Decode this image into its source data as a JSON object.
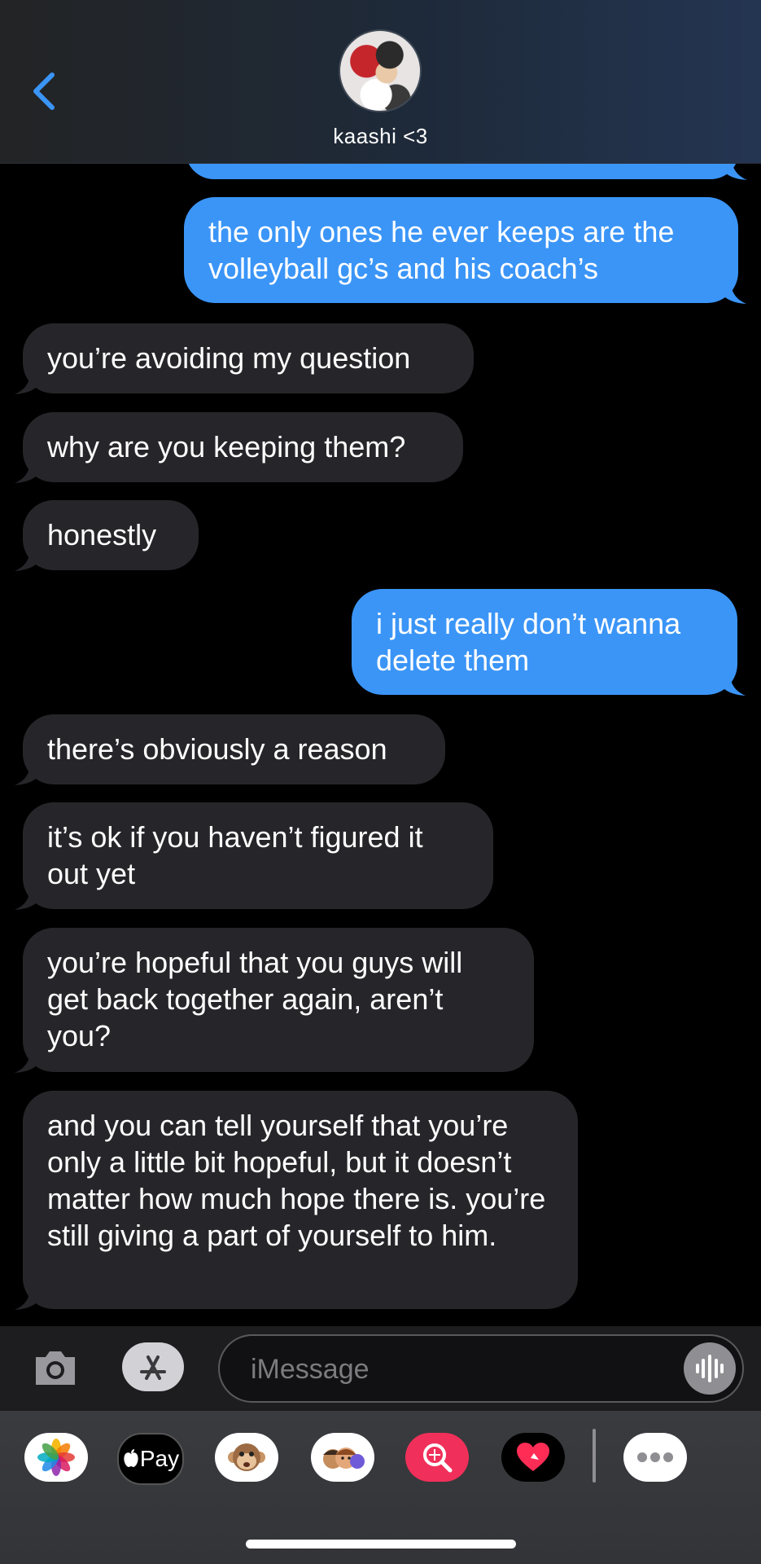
{
  "header": {
    "back_label": "back",
    "contact_name": "kaashi <3"
  },
  "messages": [
    {
      "direction": "outgoing",
      "text": ""
    },
    {
      "direction": "outgoing",
      "text": "the only ones he ever keeps are the volleyball gc’s and his coach’s"
    },
    {
      "direction": "incoming",
      "text": "you’re avoiding my question"
    },
    {
      "direction": "incoming",
      "text": "why are you keeping them?"
    },
    {
      "direction": "incoming",
      "text": "honestly"
    },
    {
      "direction": "outgoing",
      "text": "i just really don’t wanna delete them"
    },
    {
      "direction": "incoming",
      "text": "there’s obviously a reason"
    },
    {
      "direction": "incoming",
      "text": "it’s ok if you haven’t figured it out yet"
    },
    {
      "direction": "incoming",
      "text": "you’re hopeful that you guys will get back together again, aren’t you?"
    },
    {
      "direction": "incoming",
      "text": "and you can tell yourself that you’re only a little bit hopeful, but it doesn’t matter how much hope there is. you’re still giving a part of yourself to him."
    }
  ],
  "composer": {
    "placeholder": "iMessage"
  },
  "app_drawer": {
    "apple_pay_label": "Pay",
    "items": [
      "photos-icon",
      "apple-pay-icon",
      "monkey-memoji-icon",
      "memoji-stickers-icon",
      "image-search-icon",
      "digital-touch-icon",
      "more-icon"
    ]
  },
  "colors": {
    "outgoing_bubble": "#3b95f7",
    "incoming_bubble": "#26262a",
    "accent": "#3b95f7"
  }
}
